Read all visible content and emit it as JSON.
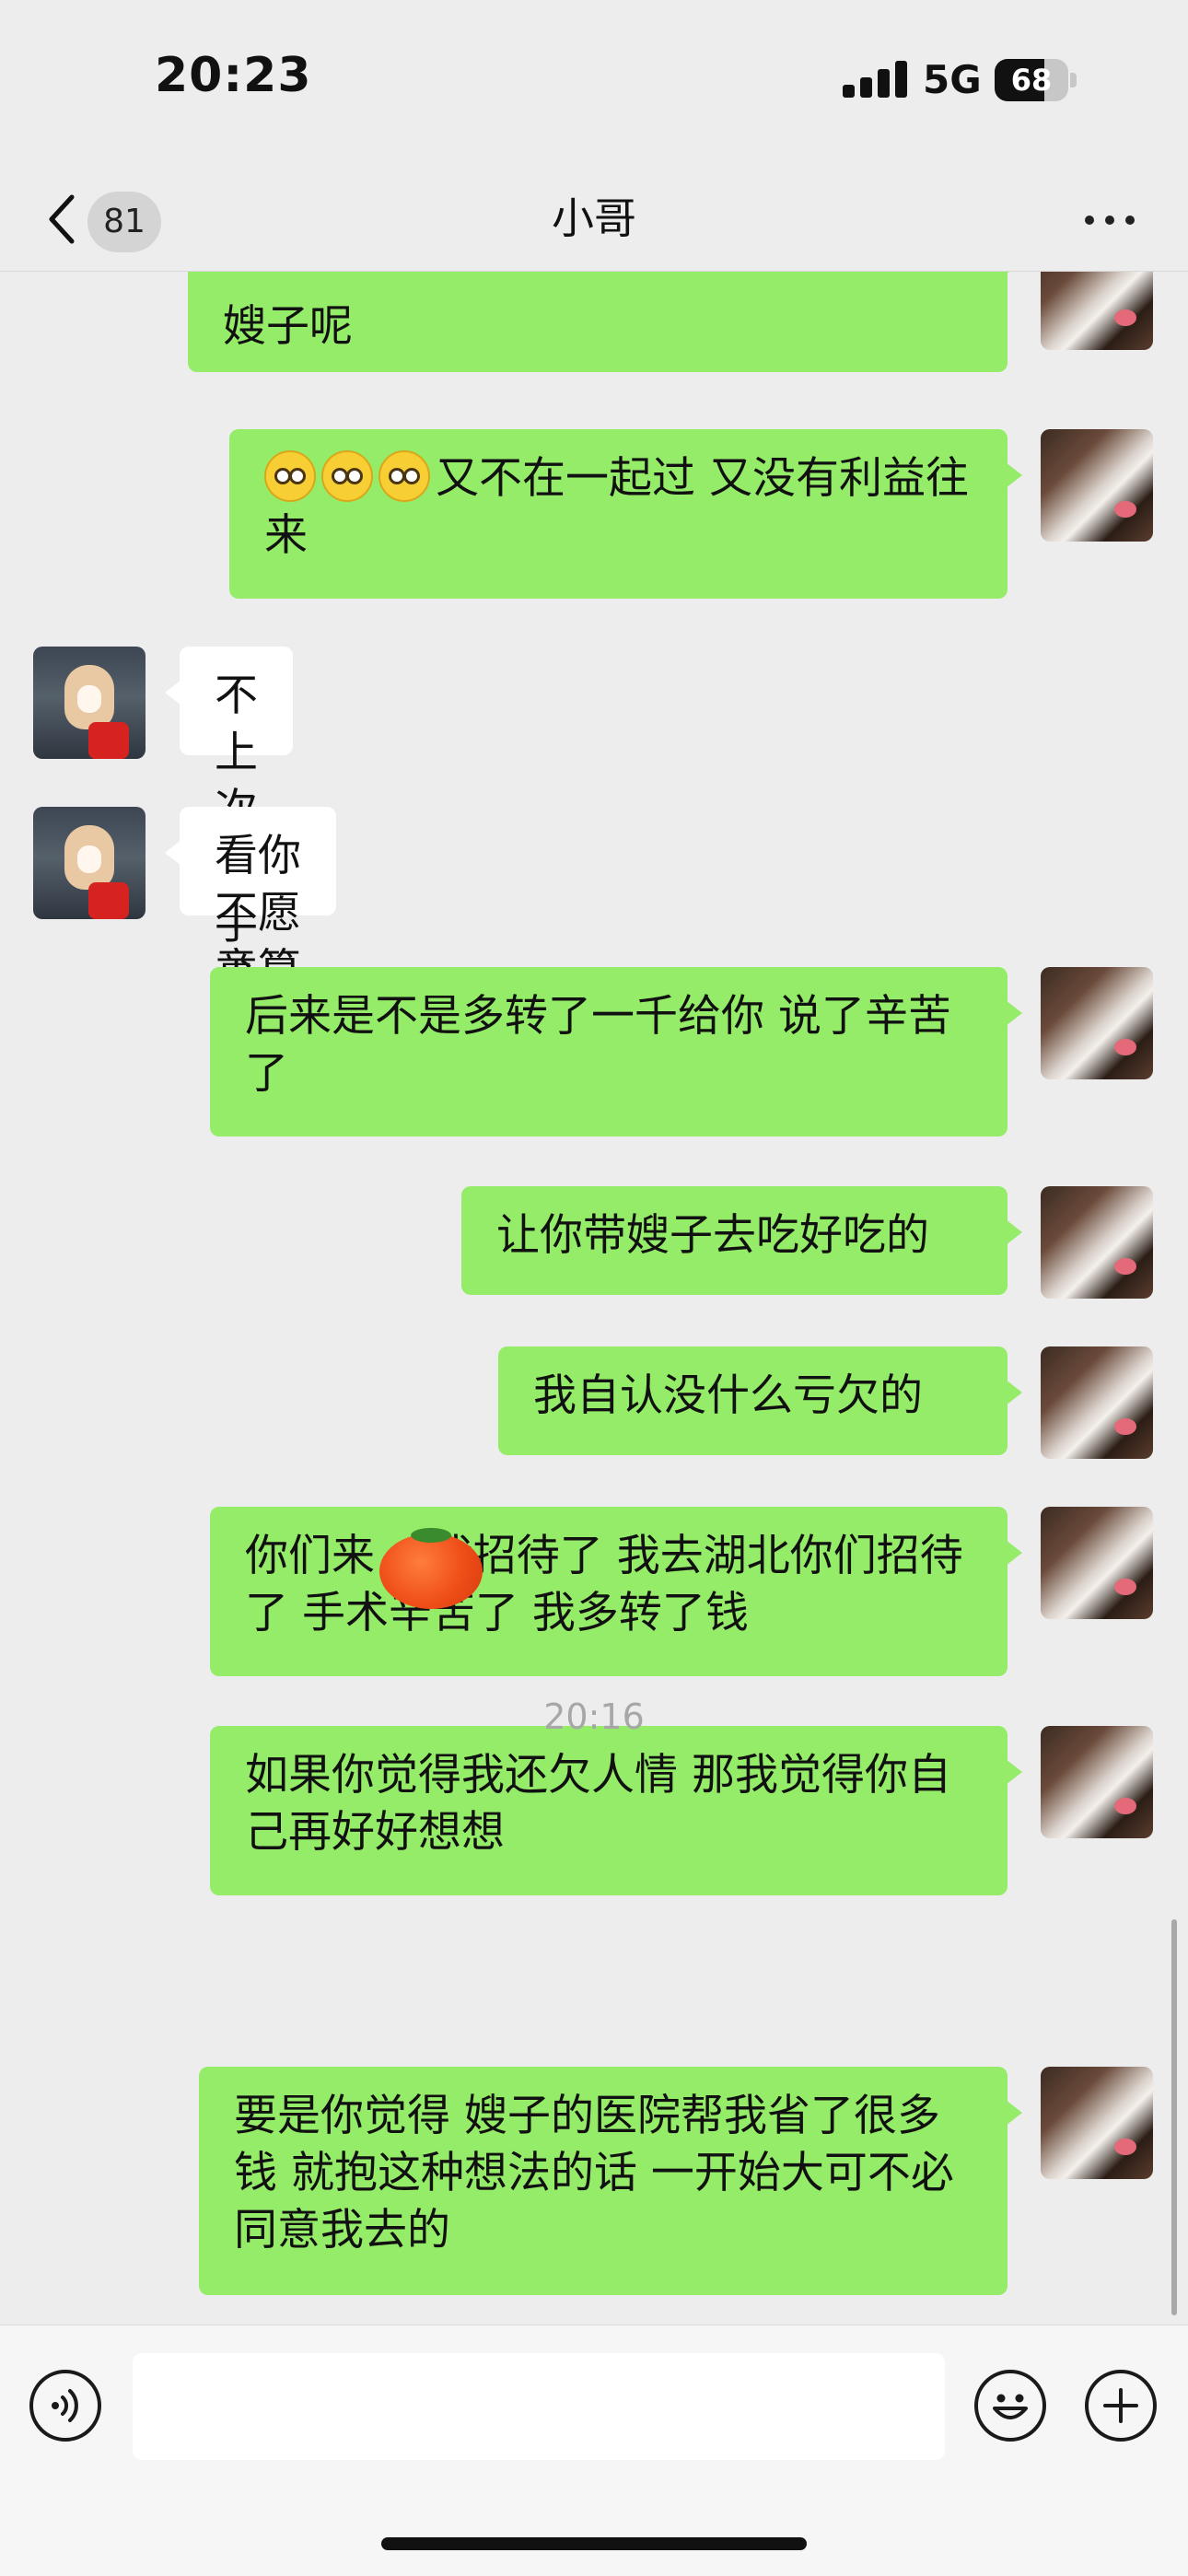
{
  "status_bar": {
    "time": "20:23",
    "network": "5G",
    "battery": "68",
    "battery_level_percent": 68
  },
  "nav": {
    "back_icon": "chevron-left-icon",
    "unread_count": "81",
    "title": "小哥",
    "more_icon": "more-dots-icon"
  },
  "messages": [
    {
      "from": "me",
      "text": "嫂子呢"
    },
    {
      "from": "me",
      "text": "又不在一起过 又没有利益往来",
      "emoji_prefix": [
        "slightly-smiling-face-icon",
        "slightly-smiling-face-icon",
        "slightly-smiling-face-icon"
      ]
    },
    {
      "from": "them",
      "text": "不上次做手术嘛"
    },
    {
      "from": "them",
      "text": "看你 不愿意算了。"
    },
    {
      "from": "me",
      "text": "后来是不是多转了一千给你 说了辛苦了"
    },
    {
      "from": "me",
      "text": "让你带嫂子去吃好吃的"
    },
    {
      "from": "me",
      "text": "我自认没什么亏欠的"
    },
    {
      "from": "me",
      "text": "你们来    我招待了 我去湖北你们招待了 手术辛苦了 我多转了钱",
      "sticker": "tomato-sticker-icon"
    },
    {
      "from": "me",
      "text": "如果你觉得我还欠人情 那我觉得你自己再好好想想"
    },
    {
      "from": "me",
      "text": "要是你觉得 嫂子的医院帮我省了很多钱 就抱这种想法的话 一开始大可不必同意我去的"
    }
  ],
  "timestamp": "20:16",
  "input_bar": {
    "voice_icon": "voice-input-icon",
    "text_value": "",
    "emoji_icon": "emoji-icon",
    "plus_icon": "plus-icon"
  },
  "colors": {
    "background": "#ededed",
    "my_bubble": "#95ec69",
    "their_bubble": "#ffffff",
    "timestamp": "#a7a7a7"
  }
}
